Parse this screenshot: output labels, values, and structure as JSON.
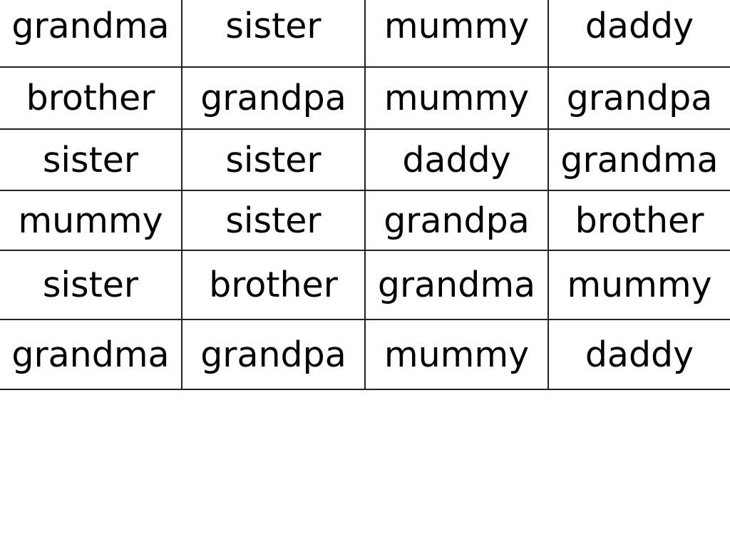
{
  "table": {
    "rows": [
      [
        "grandma",
        "sister",
        "mummy",
        "daddy"
      ],
      [
        "brother",
        "grandpa",
        "mummy",
        "grandpa"
      ],
      [
        "sister",
        "sister",
        "daddy",
        "grandma"
      ],
      [
        "mummy",
        "sister",
        "grandpa",
        "brother"
      ],
      [
        "sister",
        "brother",
        "grandma",
        "mummy"
      ],
      [
        "grandma",
        "grandpa",
        "mummy",
        "daddy"
      ]
    ]
  }
}
